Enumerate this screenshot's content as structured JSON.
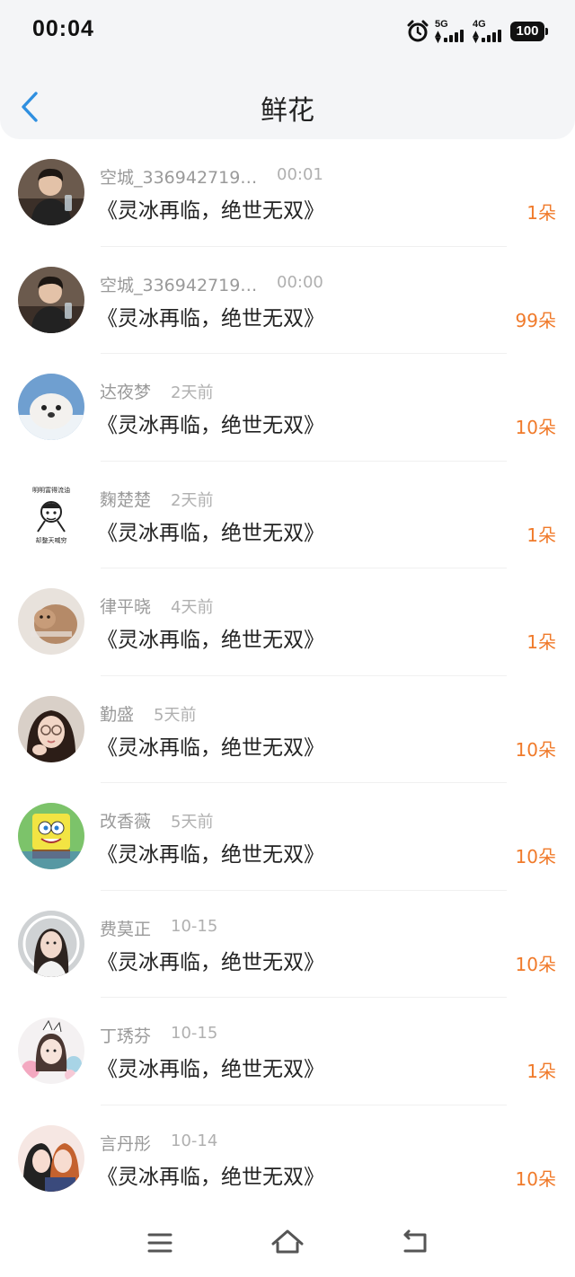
{
  "status_bar": {
    "time": "00:04",
    "network1": "5G",
    "network2": "4G",
    "battery": "100"
  },
  "header": {
    "title": "鲜花"
  },
  "items": [
    {
      "name": "空城_336942719…",
      "time": "00:01",
      "book": "《灵冰再临，绝世无双》",
      "count": "1朵"
    },
    {
      "name": "空城_336942719…",
      "time": "00:00",
      "book": "《灵冰再临，绝世无双》",
      "count": "99朵"
    },
    {
      "name": "达夜梦",
      "time": "2天前",
      "book": "《灵冰再临，绝世无双》",
      "count": "10朵"
    },
    {
      "name": "麴楚楚",
      "time": "2天前",
      "book": "《灵冰再临，绝世无双》",
      "count": "1朵"
    },
    {
      "name": "律平晓",
      "time": "4天前",
      "book": "《灵冰再临，绝世无双》",
      "count": "1朵"
    },
    {
      "name": "勤盛",
      "time": "5天前",
      "book": "《灵冰再临，绝世无双》",
      "count": "10朵"
    },
    {
      "name": "改香薇",
      "time": "5天前",
      "book": "《灵冰再临，绝世无双》",
      "count": "10朵"
    },
    {
      "name": "费莫正",
      "time": "10-15",
      "book": "《灵冰再临，绝世无双》",
      "count": "10朵"
    },
    {
      "name": "丁琇芬",
      "time": "10-15",
      "book": "《灵冰再临，绝世无双》",
      "count": "1朵"
    },
    {
      "name": "言丹彤",
      "time": "10-14",
      "book": "《灵冰再临，绝世无双》",
      "count": "10朵"
    }
  ],
  "meme_text": {
    "top": "明明富得流油",
    "bottom": "却整天喊穷"
  },
  "colors": {
    "accent_orange": "#f07a2a",
    "back_blue": "#2f8fe0"
  }
}
